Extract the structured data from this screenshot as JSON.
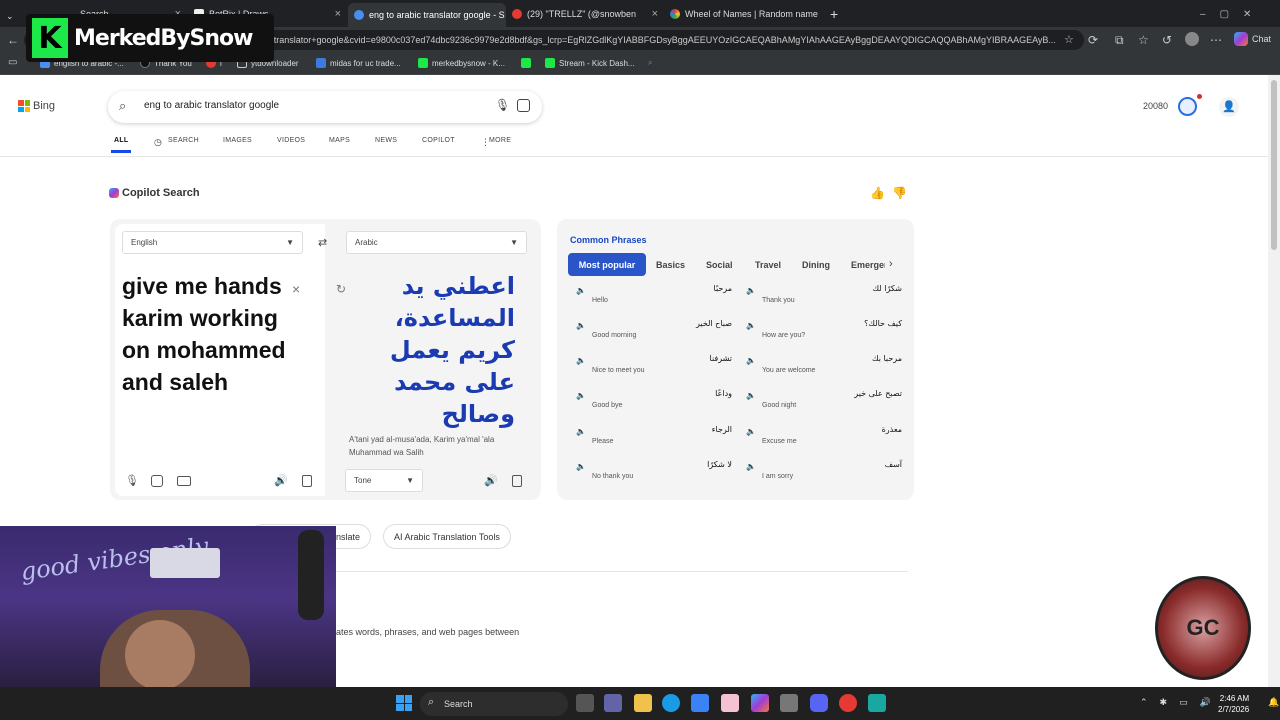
{
  "tabs": [
    {
      "title": "Search"
    },
    {
      "title": "BotRix | Draws"
    },
    {
      "title": "eng to arabic translator google - S"
    },
    {
      "title": "(29) \"TRELLZ\" (@snowben"
    },
    {
      "title": "Wheel of Names | Random name p"
    }
  ],
  "address_bar": {
    "url": "c+translator+google&cvid=e9800c037ed74dbc9236c9979e2d8bdf&gs_lcrp=EgRlZGdlKgYIABBFGDsyBggAEEUYOzIGCAEQABhAMgYIAhAAGEAyBggDEAAYQDIGCAQQABhAMgYIBRAAGEAyB...",
    "chat_label": "Chat"
  },
  "bookmarks": [
    "english to arabic -...",
    "Thank You",
    "i",
    "ytdownloader",
    "midas for uc trade...",
    "merkedbysnow - K...",
    "",
    "Stream - Kick Dash..."
  ],
  "overlay_logo": {
    "text": "MerkedBySnow",
    "letter": "K"
  },
  "bing": {
    "brand": "Bing",
    "query": "eng to arabic translator google",
    "nav": [
      "ALL",
      "SEARCH",
      "IMAGES",
      "VIDEOS",
      "MAPS",
      "NEWS",
      "COPILOT",
      "MORE"
    ],
    "rewards_points": "20080"
  },
  "copilot": {
    "title": "Copilot Search"
  },
  "translator": {
    "source_lang": "English",
    "target_lang": "Arabic",
    "source_text": "give me hands karim working on mohammed and saleh",
    "target_text": "اعطني يد المساعدة، كريم يعمل على محمد وصالح",
    "transliteration": "A'tani yad al-musa'ada, Karim ya'mal 'ala Muhammad wa Salih",
    "tone_label": "Tone"
  },
  "phrases": {
    "title": "Common Phrases",
    "tabs": [
      "Most popular",
      "Basics",
      "Social",
      "Travel",
      "Dining",
      "Emergen"
    ],
    "items": [
      {
        "en": "Hello",
        "ar": "مرحبًا"
      },
      {
        "en": "Thank you",
        "ar": "شكرًا لك"
      },
      {
        "en": "Good morning",
        "ar": "صباح الخير"
      },
      {
        "en": "How are you?",
        "ar": "كيف حالك؟"
      },
      {
        "en": "Nice to meet you",
        "ar": "تشرفنا"
      },
      {
        "en": "You are welcome",
        "ar": "مرحبا بك"
      },
      {
        "en": "Good bye",
        "ar": "وداعًا"
      },
      {
        "en": "Good night",
        "ar": "تصبح على خير"
      },
      {
        "en": "Please",
        "ar": "الرجاء"
      },
      {
        "en": "Excuse me",
        "ar": "معذرة"
      },
      {
        "en": "No thank you",
        "ar": "لا شكرًا"
      },
      {
        "en": "I am sorry",
        "ar": "آسف"
      }
    ]
  },
  "related": [
    "anslate",
    "AI Arabic Translation Tools"
  ],
  "snippet": "ates words, phrases, and web pages between",
  "webcam": {
    "neon_text": "good vibes only"
  },
  "badge": {
    "text": "GC"
  },
  "taskbar": {
    "search_label": "Search",
    "time": "2:46 AM",
    "date": "2/7/2026"
  }
}
